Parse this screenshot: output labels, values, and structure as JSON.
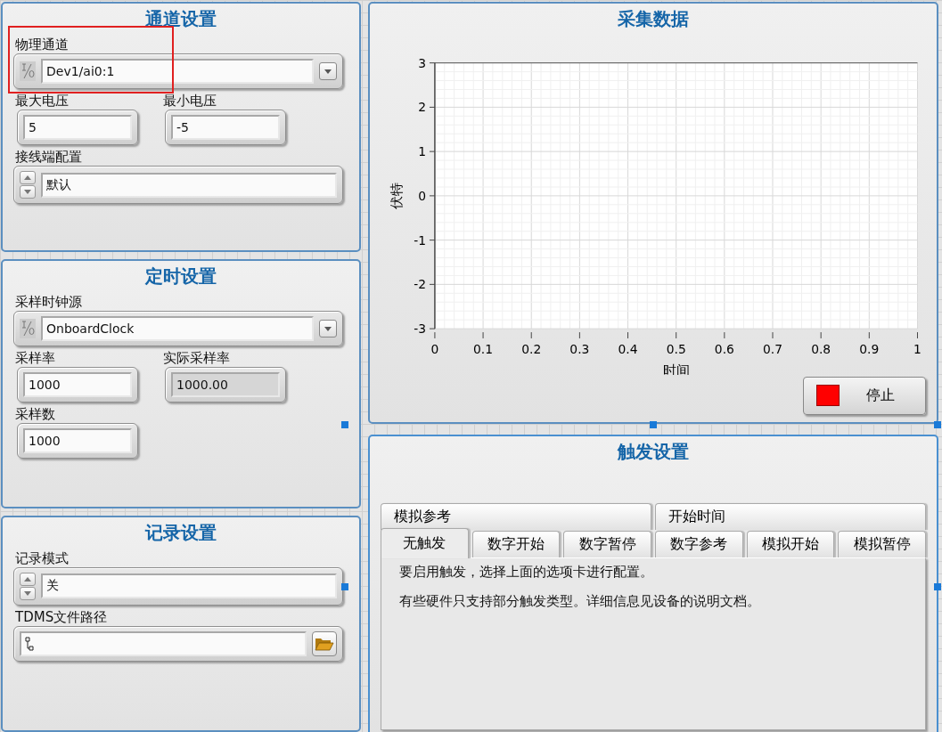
{
  "left_panels": [
    {
      "title": "通道设置",
      "selected": false,
      "rows": [
        [
          {
            "kind": "io",
            "label": "物理通道",
            "value": "Dev1/ai0:1",
            "highlighted": true
          }
        ],
        [
          {
            "kind": "numeric",
            "label": "最大电压",
            "value": "5",
            "highlighted": false
          },
          {
            "kind": "numeric",
            "label": "最小电压",
            "value": "-5",
            "highlighted": false
          }
        ],
        [
          {
            "kind": "ring",
            "label": "接线端配置",
            "value": "默认",
            "highlighted": false
          }
        ]
      ]
    },
    {
      "title": "定时设置",
      "selected": false,
      "rows": [
        [
          {
            "kind": "io",
            "label": "采样时钟源",
            "value": "OnboardClock",
            "highlighted": false
          }
        ],
        [
          {
            "kind": "numeric",
            "label": "采样率",
            "value": "1000",
            "highlighted": false
          },
          {
            "kind": "indicator",
            "label": "实际采样率",
            "value": "1000.00",
            "highlighted": false
          }
        ],
        [
          {
            "kind": "numeric",
            "label": "采样数",
            "value": "1000",
            "highlighted": false
          }
        ]
      ]
    },
    {
      "title": "记录设置",
      "selected": false,
      "rows": [
        [
          {
            "kind": "ring",
            "label": "记录模式",
            "value": "关",
            "highlighted": false
          }
        ],
        [
          {
            "kind": "path",
            "label": "TDMS文件路径",
            "highlighted": false
          }
        ]
      ]
    }
  ],
  "chart_panel": {
    "title": "采集数据",
    "selected": false,
    "chart_data": {
      "type": "line",
      "xlabel": "时间",
      "ylabel": "伏特",
      "grid": true,
      "xlim": [
        0,
        1
      ],
      "ylim": [
        -3,
        3
      ],
      "xticks": [
        0,
        0.1,
        0.2,
        0.3,
        0.4,
        0.5,
        0.6,
        0.7,
        0.8,
        0.9,
        1
      ],
      "yticks": [
        -3,
        -2,
        -1,
        0,
        1,
        2,
        3
      ]
    },
    "stop_button": {
      "label": "停止"
    }
  },
  "trigger_panel": {
    "title": "触发设置",
    "selected": true,
    "back_tabs": [
      {
        "label": "模拟参考",
        "selected": false
      },
      {
        "label": "开始时间",
        "selected": false
      }
    ],
    "front_tabs": [
      {
        "label": "无触发",
        "selected": true
      },
      {
        "label": "数字开始",
        "selected": false
      },
      {
        "label": "数字暂停",
        "selected": false
      },
      {
        "label": "数字参考",
        "selected": false
      },
      {
        "label": "模拟开始",
        "selected": false
      },
      {
        "label": "模拟暂停",
        "selected": false
      }
    ],
    "paragraphs": [
      "要启用触发，选择上面的选项卡进行配置。",
      "有些硬件只支持部分触发类型。详细信息见设备的说明文档。"
    ]
  }
}
